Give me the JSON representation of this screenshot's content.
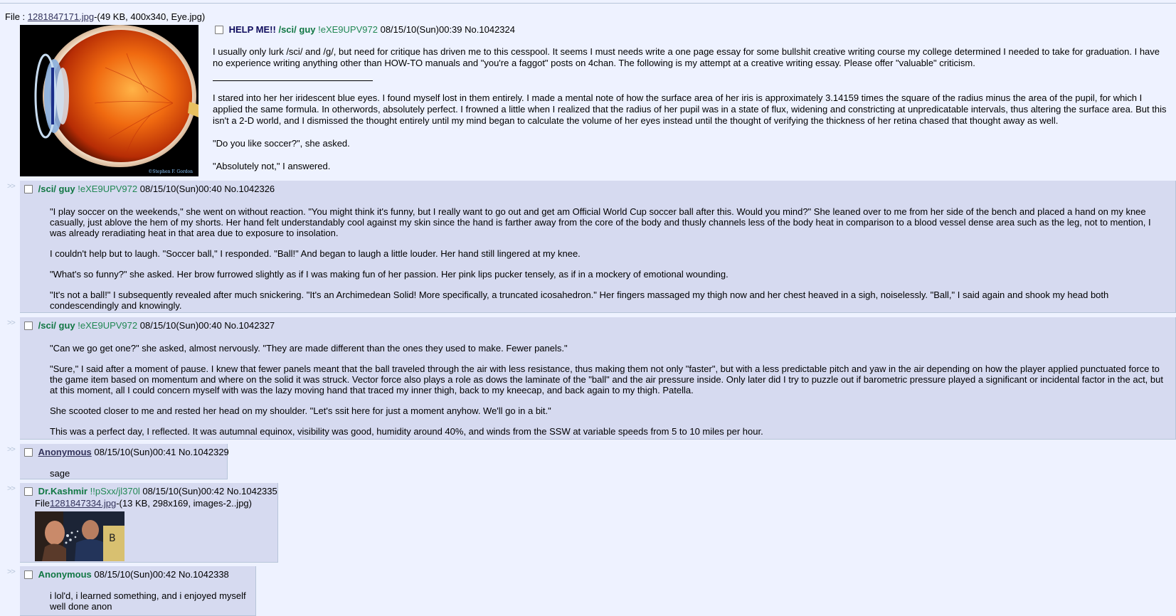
{
  "op": {
    "file_label": "File :",
    "file_name": "1281847171.jpg",
    "file_meta": "-(49 KB, 400x340, Eye.jpg)",
    "subject": "HELP ME!!",
    "name": "/sci/ guy",
    "tripcode": "!eXE9UPV972",
    "datetime": "08/15/10(Sun)00:39",
    "post_no": "No.1042324",
    "image_credit": "©Stephen F. Gordon",
    "intro": "I usually only lurk /sci/ and /g/, but need for critique has driven me to this cesspool. It seems I must needs write a one page essay for some bullshit creative writing course my college determined I needed to take for graduation. I have no experience writing anything other than HOW-TO manuals and \"you're a faggot\" posts on 4chan. The following is my attempt at a creative writing essay. Please offer \"valuable\" criticism.",
    "paragraphs": [
      "I stared into her her iridescent blue eyes. I found myself lost in them entirely. I made a mental note of how the surface area of her iris is approximately 3.14159 times the square of the radius minus the area of the pupil, for which I applied the same formula. In otherwords, absolutely perfect. I frowned a little when I realized that the radius of her pupil was in a state of flux, widening and constricting at unpredicatable intervals, thus altering the surface area. But this isn't a 2-D world, and I dismissed the thought entirely until my mind began to calculate the volume of her eyes instead until the thought of verifying the thickness of her retina chased that thought away as well.",
      "\"Do you like soccer?\", she asked.",
      "\"Absolutely not,\" I answered."
    ]
  },
  "reply_arrows": ">>",
  "replies": [
    {
      "name": "/sci/ guy",
      "tripcode": "!eXE9UPV972",
      "datetime": "08/15/10(Sun)00:40",
      "post_no": "No.1042326",
      "paragraphs": [
        "\"I play soccer on the weekends,\" she went on without reaction. \"You might think it's funny, but I really want to go out and get am Official World Cup soccer ball after this. Would you mind?\" She leaned over to me from her side of the bench and placed a hand on my knee casually, just ablove the hem of my shorts. Her hand felt understandably cool against my skin since the hand is farther away from the core of the body and thusly channels less of the body heat in comparison to a blood vessel dense area such as the leg, not to mention, I was already reradiating heat in that area due to exposure to insolation.",
        "I couldn't help but to laugh. \"Soccer ball,\" I responded. \"Ball!\" And began to laugh a little louder. Her hand still lingered at my knee.",
        "\"What's so funny?\" she asked. Her brow furrowed slightly as if I was making fun of her passion. Her pink lips pucker tensely, as if in a mockery of emotional wounding.",
        "\"It's not a ball!\" I subsequently revealed after much snickering. \"It's an Archimedean Solid! More specifically, a truncated icosahedron.\" Her fingers massaged my thigh now and her chest heaved in a sigh, noiselessly. \"Ball,\" I said again and shook my head both condescendingly and knowingly."
      ]
    },
    {
      "name": "/sci/ guy",
      "tripcode": "!eXE9UPV972",
      "datetime": "08/15/10(Sun)00:40",
      "post_no": "No.1042327",
      "paragraphs": [
        "\"Can we go get one?\" she asked, almost nervously. \"They are made different than the ones they used to make. Fewer panels.\"",
        "\"Sure,\" I said after a moment of pause. I knew that fewer panels meant that the ball traveled through the air with less resistance, thus making them not only \"faster\", but with a less predictable pitch and yaw in the air depending on how the player applied punctuated force to the game item based on momentum and where on the solid it was struck. Vector force also plays a role as dows the laminate of the \"ball\" and the air pressure inside. Only later did I try to puzzle out if barometric pressure played a significant or incidental factor in the act, but at this moment, all I could concern myself with was the lazy moving hand that traced my inner thigh, back to my kneecap, and back again to my thigh. Patella.",
        "She scooted closer to me and rested her head on my shoulder. \"Let's ssit here for just a moment anyhow. We'll go in a bit.\"",
        "This was a perfect day, I reflected. It was autumnal equinox, visibility was good, humidity around 40%, and winds from the SSW at variable speeds from 5 to 10 miles per hour."
      ]
    },
    {
      "name": "Anonymous",
      "datetime": "08/15/10(Sun)00:41",
      "post_no": "No.1042329",
      "paragraphs": [
        "sage"
      ]
    },
    {
      "name": "Dr.Kashmir",
      "tripcode": "!!pSxx/jl370l",
      "datetime": "08/15/10(Sun)00:42",
      "post_no": "No.1042335",
      "file_label": "File",
      "file_name": "1281847334.jpg",
      "file_meta": "-(13 KB, 298x169, images-2..jpg)"
    },
    {
      "name": "Anonymous",
      "datetime": "08/15/10(Sun)00:42",
      "post_no": "No.1042338",
      "paragraphs": [
        "i lol'd, i learned something, and i enjoyed myself",
        "well done anon"
      ]
    }
  ]
}
